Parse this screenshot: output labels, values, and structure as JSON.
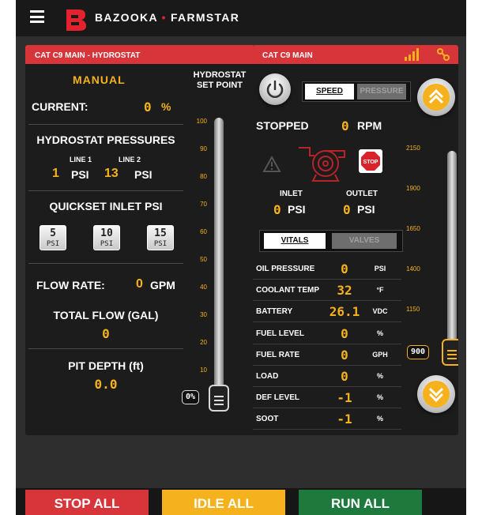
{
  "header": {
    "brand_left": "BAZOOKA",
    "brand_sep": "•",
    "brand_right": "FARMSTAR",
    "menu_icon": "hamburger-menu-icon",
    "logo_icon": "bazooka-logo-icon"
  },
  "left_panel": {
    "title": "CAT C9 MAIN - HYDROSTAT",
    "mode": "MANUAL",
    "current_label": "CURRENT:",
    "current_value": "0",
    "current_unit": "%",
    "pressures_title": "HYDROSTAT PRESSURES",
    "line1_label": "LINE 1",
    "line2_label": "LINE 2",
    "line1_value": "1",
    "line2_value": "13",
    "psi_unit": "PSI",
    "quickset_title": "QUICKSET INLET PSI",
    "quickset_buttons": [
      {
        "value": "5",
        "unit": "PSI"
      },
      {
        "value": "10",
        "unit": "PSI"
      },
      {
        "value": "15",
        "unit": "PSI"
      }
    ],
    "flow_label": "FLOW RATE:",
    "flow_value": "0",
    "flow_unit": "GPM",
    "total_flow_label": "TOTAL FLOW (GAL)",
    "total_flow_value": "0",
    "pit_depth_label": "PIT DEPTH (ft)",
    "pit_depth_value": "0.0",
    "setpoint_title_1": "HYDROSTAT",
    "setpoint_title_2": "SET POINT",
    "setpoint_ticks": [
      "100",
      "90",
      "80",
      "70",
      "60",
      "50",
      "40",
      "30",
      "20",
      "10"
    ],
    "setpoint_value": "0%",
    "setpoint_level": 0
  },
  "right_panel": {
    "title": "CAT C9 MAIN",
    "signal_icon": "signal-bars-icon",
    "link_icon": "connection-icon",
    "power_icon": "power-icon",
    "tab_speed": "SPEED",
    "tab_pressure": "PRESSURE",
    "status": "STOPPED",
    "rpm_value": "0",
    "rpm_unit": "RPM",
    "warning_icon": "warning-triangle-icon",
    "pump_icon": "pump-icon",
    "stop_sign": "STOP",
    "inlet_label": "INLET",
    "outlet_label": "OUTLET",
    "inlet_value": "0",
    "outlet_value": "0",
    "psi_unit": "PSI",
    "tab_vitals": "VITALS",
    "tab_valves": "VALVES",
    "vitals": [
      {
        "label": "OIL PRESSURE",
        "value": "0",
        "unit": "PSI"
      },
      {
        "label": "COOLANT TEMP",
        "value": "32",
        "unit": "°F"
      },
      {
        "label": "BATTERY",
        "value": "26.1",
        "unit": "VDC"
      },
      {
        "label": "FUEL LEVEL",
        "value": "0",
        "unit": "%"
      },
      {
        "label": "FUEL RATE",
        "value": "0",
        "unit": "GPH"
      },
      {
        "label": "LOAD",
        "value": "0",
        "unit": "%"
      },
      {
        "label": "DEF LEVEL",
        "value": "-1",
        "unit": "%"
      },
      {
        "label": "SOOT",
        "value": "-1",
        "unit": "%"
      }
    ],
    "rpm_ticks": [
      "2150",
      "1900",
      "1650",
      "1400",
      "1150"
    ],
    "rpm_setpoint": "900",
    "up_icon": "double-chevron-up-icon",
    "down_icon": "double-chevron-down-icon"
  },
  "footer": {
    "stop_all": "STOP ALL",
    "idle_all": "IDLE ALL",
    "run_all": "RUN ALL"
  },
  "colors": {
    "accent_red": "#d8353b",
    "accent_orange": "#f5b21c",
    "run_green": "#1e7a3c"
  }
}
